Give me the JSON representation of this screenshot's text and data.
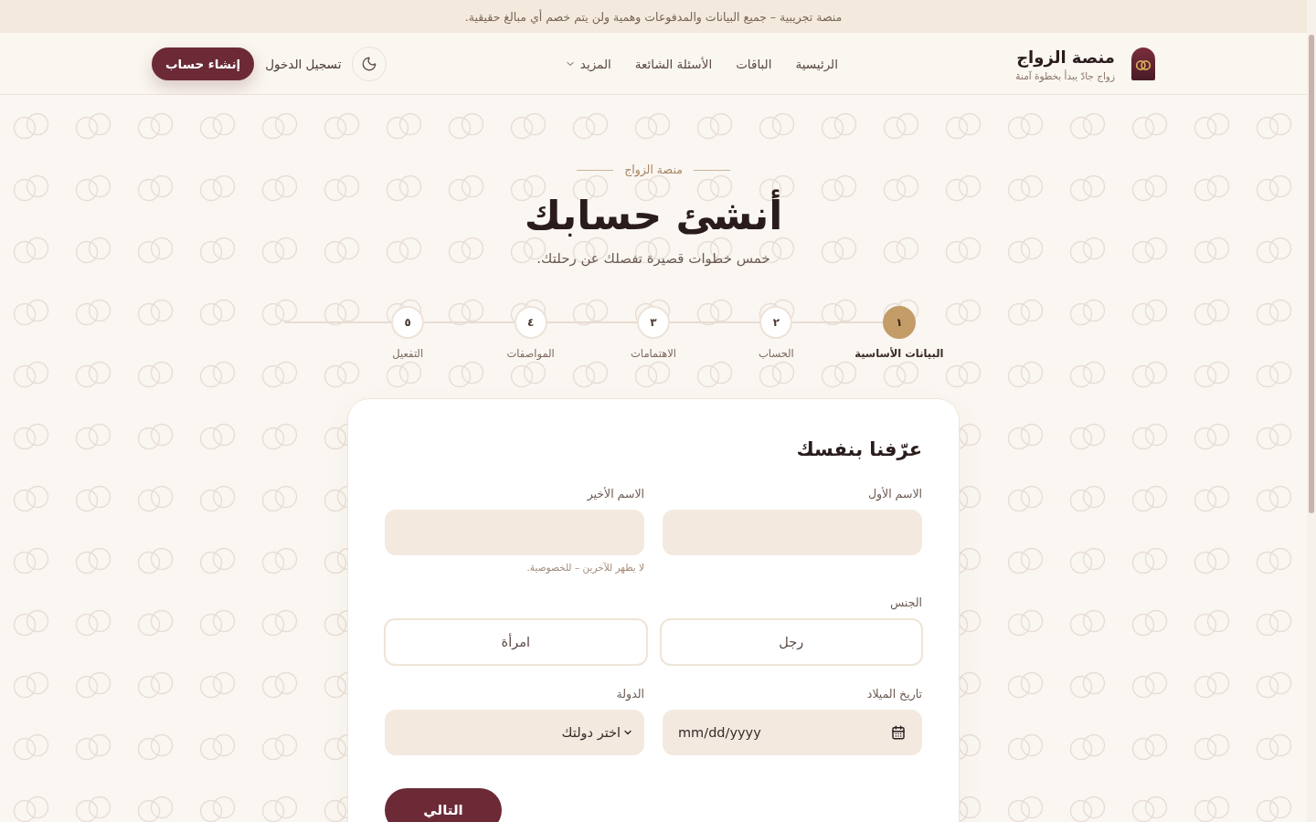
{
  "banner": {
    "text": "منصة تجريبية – جميع البيانات والمدفوعات وهمية ولن يتم خصم أي مبالغ حقيقية."
  },
  "header": {
    "brand": {
      "title": "منصة الزواج",
      "tagline": "زواج جادّ يبدأ بخطوة آمنة"
    },
    "nav": [
      {
        "label": "الرئيسية",
        "kind": "link"
      },
      {
        "label": "الباقات",
        "kind": "link"
      },
      {
        "label": "الأسئلة الشائعة",
        "kind": "link"
      },
      {
        "label": "المزيد",
        "kind": "dropdown"
      }
    ],
    "login": "تسجيل الدخول",
    "signup": "إنشاء حساب"
  },
  "hero": {
    "eyebrow": "منصة الزواج",
    "title": "أنشئ حسابك",
    "subtitle": "خمس خطوات قصيرة تفصلك عن رحلتك."
  },
  "steps": [
    {
      "number": "١",
      "label": "البيانات الأساسية",
      "selected": true
    },
    {
      "number": "٢",
      "label": "الحساب",
      "selected": false
    },
    {
      "number": "٣",
      "label": "الاهتمامات",
      "selected": false
    },
    {
      "number": "٤",
      "label": "المواصفات",
      "selected": false
    },
    {
      "number": "٥",
      "label": "التفعيل",
      "selected": false
    }
  ],
  "form": {
    "title": "عرّفنا بنفسك",
    "fields": [
      {
        "kind": "text",
        "label": "الاسم الأول"
      },
      {
        "kind": "text",
        "label": "الاسم الأخير",
        "hint": "لا يظهر للآخرين – للخصوصية."
      },
      {
        "kind": "choice",
        "label": "الجنس",
        "options": [
          {
            "label": "رجل",
            "selected": false
          },
          {
            "label": "امرأة",
            "selected": false
          }
        ]
      },
      {
        "kind": "date",
        "label": "تاريخ الميلاد",
        "placeholder": "mm/dd/yyyy"
      },
      {
        "kind": "select",
        "label": "الدولة",
        "placeholder": "اختر دولتك"
      }
    ],
    "next_button": "التالي"
  }
}
